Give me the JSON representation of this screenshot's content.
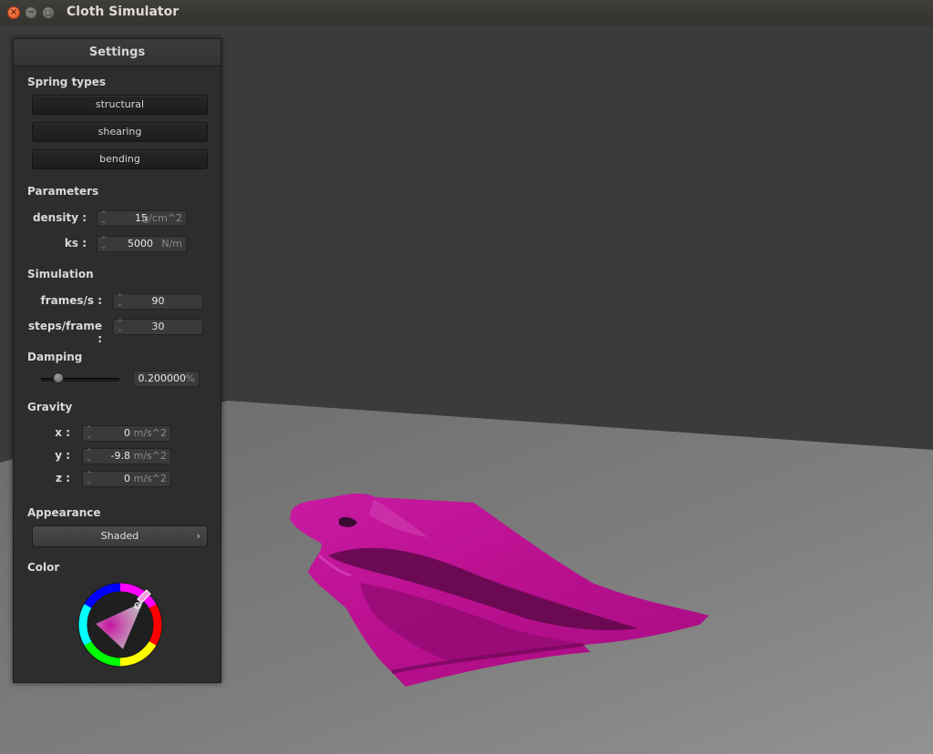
{
  "window": {
    "title": "Cloth Simulator"
  },
  "panel": {
    "title": "Settings",
    "spring_types": {
      "heading": "Spring types",
      "buttons": [
        "structural",
        "shearing",
        "bending"
      ]
    },
    "parameters": {
      "heading": "Parameters",
      "density": {
        "label": "density :",
        "value": "15",
        "unit": "g/cm^2"
      },
      "ks": {
        "label": "ks :",
        "value": "5000",
        "unit": "N/m"
      }
    },
    "simulation": {
      "heading": "Simulation",
      "fps": {
        "label": "frames/s :",
        "value": "90"
      },
      "steps": {
        "label": "steps/frame :",
        "value": "30"
      }
    },
    "damping": {
      "heading": "Damping",
      "value": "0.200000",
      "unit": "%",
      "slider_fraction": 0.2
    },
    "gravity": {
      "heading": "Gravity",
      "x": {
        "label": "x :",
        "value": "0",
        "unit": "m/s^2"
      },
      "y": {
        "label": "y :",
        "value": "-9.8",
        "unit": "m/s^2"
      },
      "z": {
        "label": "z :",
        "value": "0",
        "unit": "m/s^2"
      }
    },
    "appearance": {
      "heading": "Appearance",
      "selected": "Shaded",
      "arrow": "›"
    },
    "color": {
      "heading": "Color",
      "value": "#c5129e"
    }
  },
  "scene": {
    "cloth_color": "#c5129e",
    "background_color": "#3b3b3b",
    "floor_color": "#7f7f7f"
  }
}
